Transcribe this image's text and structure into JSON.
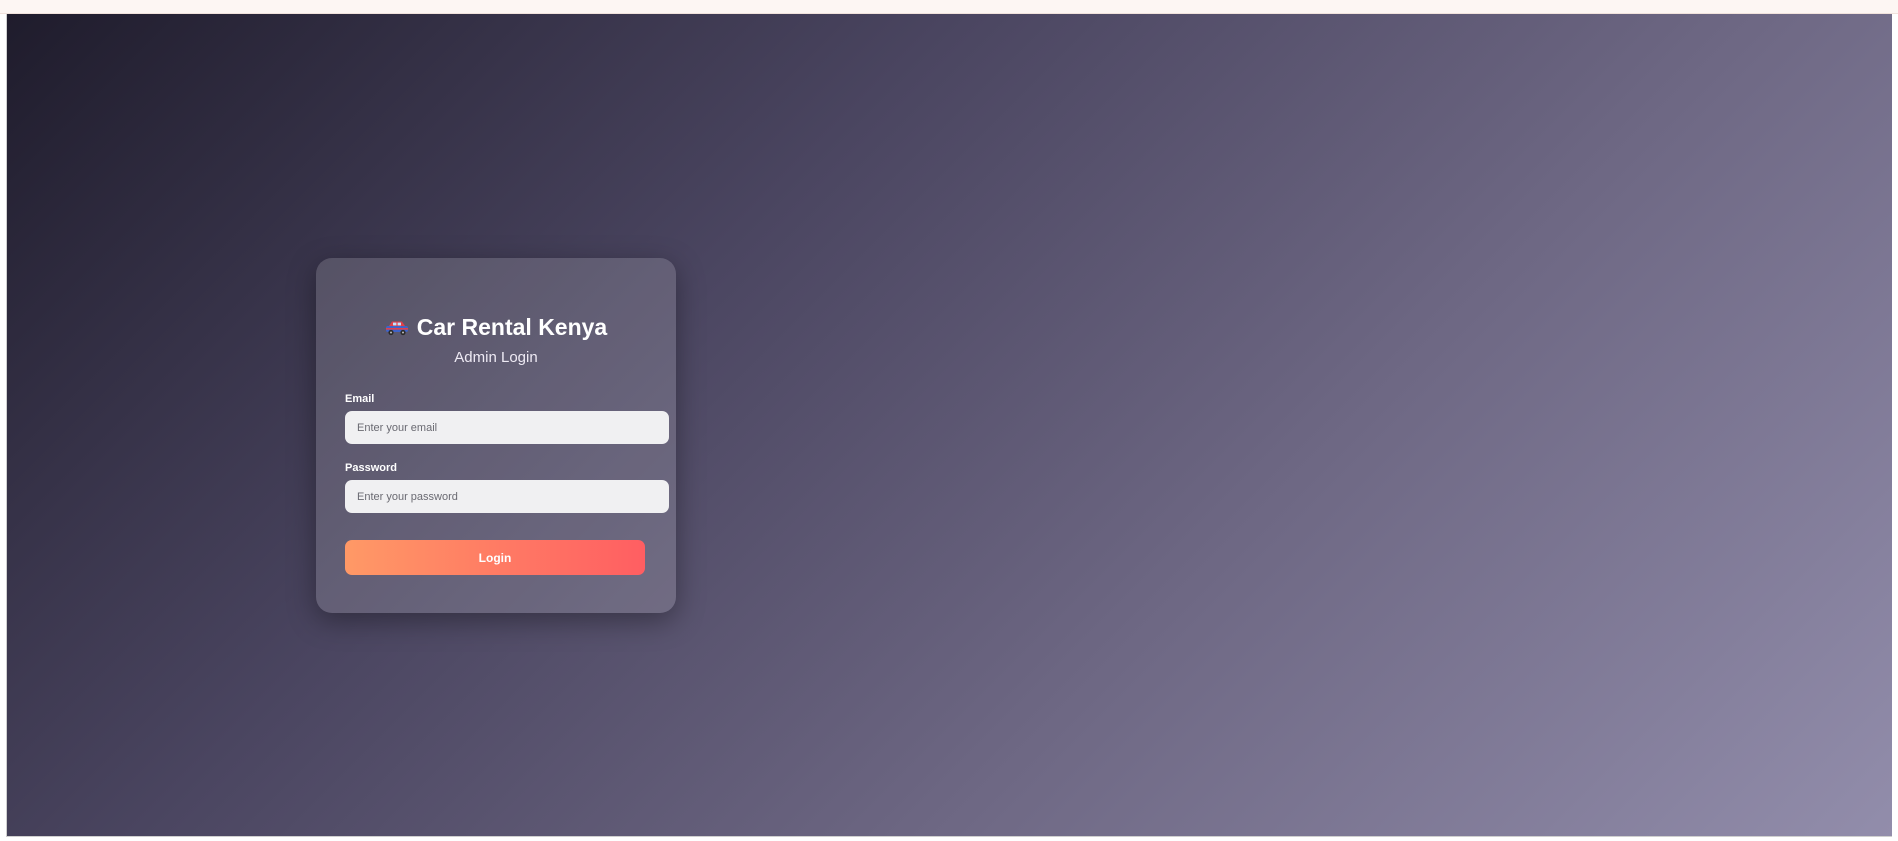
{
  "header": {
    "brand_icon": "car-icon",
    "title": "Car Rental Kenya",
    "subtitle": "Admin Login"
  },
  "form": {
    "email": {
      "label": "Email",
      "placeholder": "Enter your email",
      "value": ""
    },
    "password": {
      "label": "Password",
      "placeholder": "Enter your password",
      "value": ""
    },
    "submit_label": "Login"
  },
  "colors": {
    "background_start": "#1f1c2c",
    "background_end": "#928dab",
    "button_start": "#ff9966",
    "button_end": "#ff5e62"
  }
}
